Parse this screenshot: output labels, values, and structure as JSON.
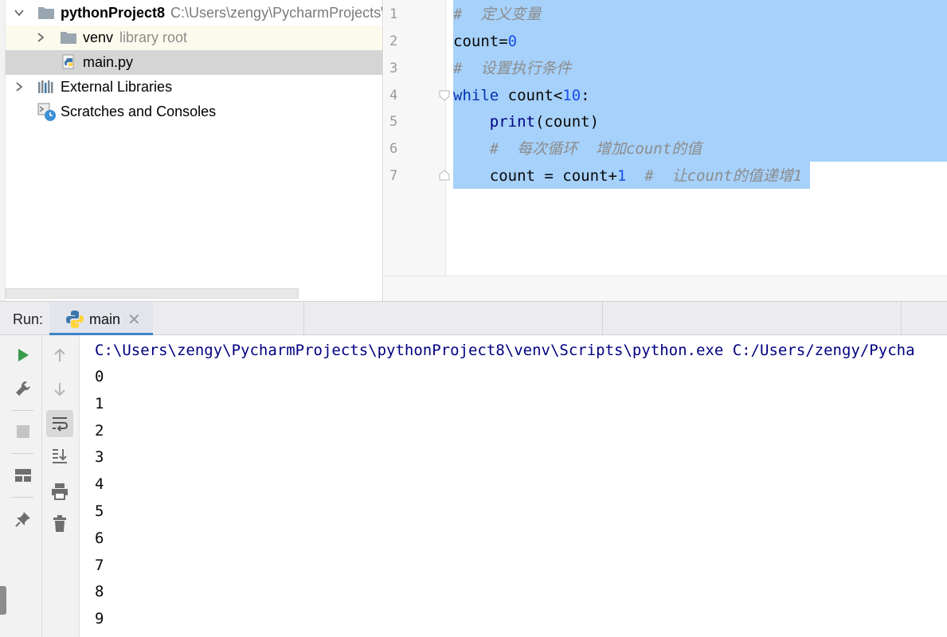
{
  "project_tree": {
    "project_name": "pythonProject8",
    "project_path": "C:\\Users\\zengy\\PycharmProjects\\",
    "items": [
      {
        "label": "venv",
        "note": "library root"
      },
      {
        "label": "main.py"
      },
      {
        "label": "External Libraries"
      },
      {
        "label": "Scratches and Consoles"
      }
    ]
  },
  "editor": {
    "line_numbers": [
      "1",
      "2",
      "3",
      "4",
      "5",
      "6",
      "7"
    ],
    "lines": [
      {
        "comment": "#  定义变量"
      },
      {
        "var": "count",
        "op": "=",
        "num": "0"
      },
      {
        "comment": "#  设置执行条件"
      },
      {
        "keyword": "while",
        "rest": " count<",
        "num": "10",
        "tail": ":"
      },
      {
        "indent": "    ",
        "func": "print",
        "rest": "(count)"
      },
      {
        "indent": "    ",
        "comment": "#  每次循环  增加count的值"
      },
      {
        "indent": "    ",
        "var": "count = count+",
        "num": "1",
        "gap": "  ",
        "comment": "#  让count的值递增1"
      }
    ]
  },
  "run": {
    "label": "Run:",
    "tab_label": "main",
    "close_glyph": "✕",
    "command": "C:\\Users\\zengy\\PycharmProjects\\pythonProject8\\venv\\Scripts\\python.exe C:/Users/zengy/Pycha",
    "output": [
      "0",
      "1",
      "2",
      "3",
      "4",
      "5",
      "6",
      "7",
      "8",
      "9"
    ],
    "tools_left": [
      "run-icon",
      "wrench-icon",
      "stop-icon",
      "layout-icon",
      "pin-icon"
    ],
    "tools_right": [
      "arrow-up-icon",
      "arrow-down-icon",
      "soft-wrap-icon",
      "scroll-to-end-icon",
      "print-icon",
      "trash-icon"
    ]
  },
  "colors": {
    "selection": "#a6d1fa",
    "keyword": "#0033b3",
    "number": "#1750eb",
    "comment": "#8c8c8c",
    "run_green": "#3a9c4c",
    "tab_underline": "#4083c9"
  }
}
